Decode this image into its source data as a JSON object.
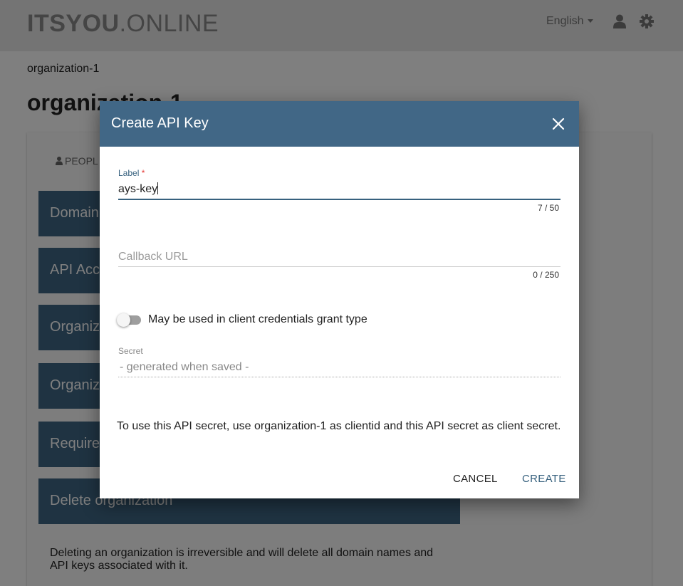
{
  "header": {
    "logo_bold": "ITSYOU",
    "logo_light": ".ONLINE",
    "language": "English",
    "icons": [
      "user-icon",
      "gear-icon"
    ]
  },
  "page": {
    "breadcrumb": "organization-1",
    "title": "organization-1",
    "tab_people": "PEOPL",
    "sections": [
      "Domain",
      "API Acc",
      "Organiz",
      "Organiz",
      "Require",
      "Delete organization"
    ],
    "delete_text": "Deleting an organization is irreversible and will delete all domain names and API keys associated with it."
  },
  "dialog": {
    "title": "Create API Key",
    "label_field": {
      "label": "Label",
      "required_mark": "*",
      "value": "ays-key",
      "counter": "7 / 50"
    },
    "callback_field": {
      "placeholder": "Callback URL",
      "counter": "0 / 250"
    },
    "toggle": {
      "label": "May be used in client credentials grant type",
      "on": false
    },
    "secret_field": {
      "label": "Secret",
      "value": "- generated when saved -"
    },
    "info_text": "To use this API secret, use organization-1 as clientid and this API secret as client secret.",
    "cancel_label": "CANCEL",
    "create_label": "CREATE"
  },
  "colors": {
    "header_bg": "#416786",
    "section_bar": "#3f6784",
    "accent_text": "#37617e",
    "required": "#e53935"
  }
}
